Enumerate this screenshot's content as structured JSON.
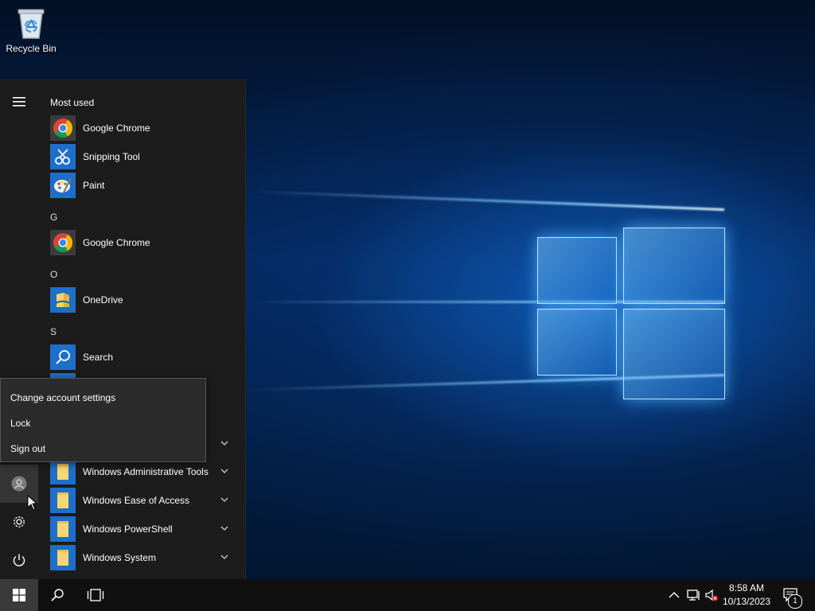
{
  "desktop": {
    "recycle_bin_label": "Recycle Bin"
  },
  "start_menu": {
    "most_used_title": "Most used",
    "most_used": [
      {
        "label": "Google Chrome",
        "icon": "chrome-icon"
      },
      {
        "label": "Snipping Tool",
        "icon": "snipping-tool-icon"
      },
      {
        "label": "Paint",
        "icon": "paint-icon"
      }
    ],
    "groups": [
      {
        "letter": "G",
        "apps": [
          {
            "label": "Google Chrome",
            "icon": "chrome-icon"
          }
        ]
      },
      {
        "letter": "O",
        "apps": [
          {
            "label": "OneDrive",
            "icon": "onedrive-icon"
          }
        ]
      },
      {
        "letter": "S",
        "apps": [
          {
            "label": "Search",
            "icon": "search-icon"
          }
        ]
      }
    ],
    "folders": [
      {
        "label": "Windows Administrative Tools",
        "icon": "folder-icon"
      },
      {
        "label": "Windows Ease of Access",
        "icon": "folder-icon"
      },
      {
        "label": "Windows PowerShell",
        "icon": "folder-icon"
      },
      {
        "label": "Windows System",
        "icon": "folder-icon"
      }
    ]
  },
  "account_popup": {
    "items": [
      "Change account settings",
      "Lock",
      "Sign out"
    ]
  },
  "taskbar": {
    "time": "8:58 AM",
    "date": "10/13/2023",
    "notification_count": "1"
  },
  "colors": {
    "accent": "#0078d7",
    "menu_bg": "#1c1c1c",
    "taskbar_bg": "#101010"
  }
}
